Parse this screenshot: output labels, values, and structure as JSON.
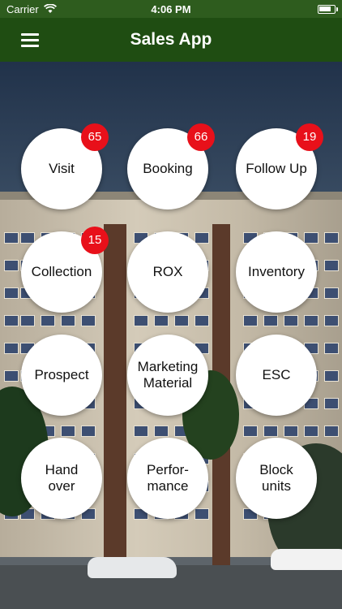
{
  "status": {
    "carrier": "Carrier",
    "time": "4:06 PM"
  },
  "nav": {
    "title": "Sales App"
  },
  "tiles": [
    {
      "label": "Visit",
      "badge": "65"
    },
    {
      "label": "Booking",
      "badge": "66"
    },
    {
      "label": "Follow Up",
      "badge": "19"
    },
    {
      "label": "Collection",
      "badge": "15"
    },
    {
      "label": "ROX",
      "badge": null
    },
    {
      "label": "Inventory",
      "badge": null
    },
    {
      "label": "Prospect",
      "badge": null
    },
    {
      "label": "Marketing\nMaterial",
      "badge": null
    },
    {
      "label": "ESC",
      "badge": null
    },
    {
      "label": "Hand\nover",
      "badge": null
    },
    {
      "label": "Perfor-\nmance",
      "badge": null
    },
    {
      "label": "Block\nunits",
      "badge": null
    }
  ],
  "colors": {
    "nav_bg": "#1f4d12",
    "badge_bg": "#e8101a",
    "tile_bg": "#ffffff"
  }
}
